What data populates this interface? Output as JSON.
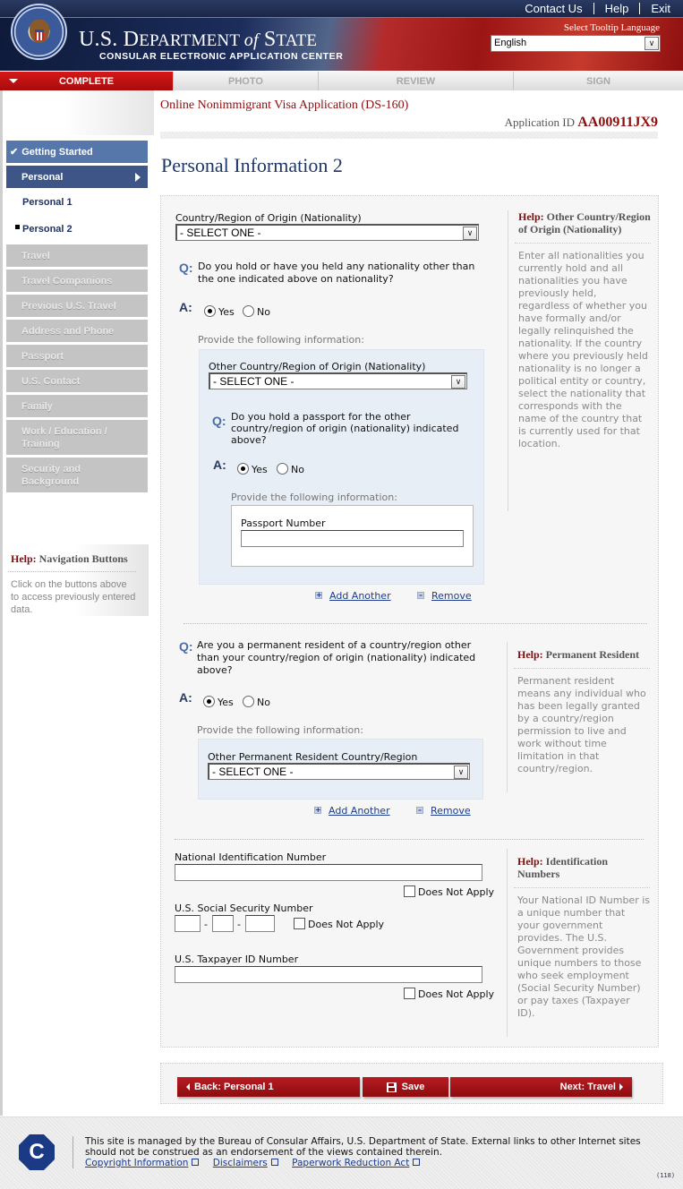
{
  "header": {
    "top_links": [
      "Contact Us",
      "Help",
      "Exit"
    ],
    "dept_name_part1": "U.S. D",
    "dept_name_part1b": "EPARTMENT ",
    "dept_name_of": "of",
    "dept_name_part2": " S",
    "dept_name_part2b": "TATE",
    "subtitle": "CONSULAR ELECTRONIC APPLICATION CENTER",
    "tooltip_language_label": "Select Tooltip Language",
    "tooltip_language_value": "English"
  },
  "progress_tabs": [
    {
      "label": "COMPLETE",
      "active": true
    },
    {
      "label": "PHOTO",
      "active": false
    },
    {
      "label": "REVIEW",
      "active": false
    },
    {
      "label": "SIGN",
      "active": false
    }
  ],
  "app": {
    "title": "Online Nonimmigrant Visa Application (DS-160)",
    "id_label": "Application ID",
    "id_value": "AA00911JX9"
  },
  "sidebar": {
    "completed": "Getting Started",
    "current": "Personal",
    "sub_items": [
      "Personal 1",
      "Personal 2"
    ],
    "locked_items": [
      "Travel",
      "Travel Companions",
      "Previous U.S. Travel",
      "Address and Phone",
      "Passport",
      "U.S. Contact",
      "Family",
      "Work / Education / Training",
      "Security and Background"
    ],
    "help_title_prefix": "Help:",
    "help_title": "Navigation Buttons",
    "help_text": "Click on the buttons above to access previously entered data."
  },
  "page": {
    "title": "Personal Information 2"
  },
  "section_nationality": {
    "nationality_label": "Country/Region of Origin (Nationality)",
    "nationality_value": "- SELECT ONE -",
    "q1_marker": "Q:",
    "q1_text": "Do you hold or have you held any nationality other than the one indicated above on nationality?",
    "a_marker": "A:",
    "q1_answer_yes": "Yes",
    "q1_answer_no": "No",
    "q1_selected": "Yes",
    "provide_info": "Provide the following information:",
    "other_nationality_label": "Other Country/Region of Origin (Nationality)",
    "other_nationality_value": "- SELECT ONE -",
    "q2_text": "Do you hold a passport for the other country/region of origin (nationality) indicated above?",
    "q2_answer_yes": "Yes",
    "q2_answer_no": "No",
    "q2_selected": "Yes",
    "passport_label": "Passport Number",
    "passport_value": "",
    "add_another": "Add Another",
    "remove": "Remove",
    "help_prefix": "Help:",
    "help_title": "Other Country/Region of Origin (Nationality)",
    "help_text": "Enter all nationalities you currently hold and all nationalities you have previously held, regardless of whether you have formally and/or legally relinquished the nationality. If the country where you previously held nationality is no longer a political entity or country, select the nationality that corresponds with the name of the country that is currently used for that location."
  },
  "section_resident": {
    "q_text": "Are you a permanent resident of a country/region other than your country/region of origin (nationality) indicated above?",
    "answer_yes": "Yes",
    "answer_no": "No",
    "selected": "Yes",
    "provide_info": "Provide the following information:",
    "country_label": "Other Permanent Resident Country/Region",
    "country_value": "- SELECT ONE -",
    "add_another": "Add Another",
    "remove": "Remove",
    "help_prefix": "Help:",
    "help_title": "Permanent Resident",
    "help_text": "Permanent resident means any individual who has been legally granted by a country/region permission to live and work without time limitation in that country/region."
  },
  "section_ids": {
    "national_id_label": "National Identification Number",
    "national_id_value": "",
    "does_not_apply": "Does Not Apply",
    "ssn_label": "U.S. Social Security Number",
    "ssn_sep": "-",
    "ssn_values": [
      "",
      "",
      ""
    ],
    "taxpayer_label": "U.S. Taxpayer ID Number",
    "taxpayer_value": "",
    "help_prefix": "Help:",
    "help_title": "Identification Numbers",
    "help_text": "Your National ID Number is a unique number that your government provides. The U.S. Government provides unique numbers to those who seek employment (Social Security Number) or pay taxes (Taxpayer ID)."
  },
  "nav_buttons": {
    "back": "Back: Personal 1",
    "save": "Save",
    "next": "Next: Travel"
  },
  "footer": {
    "logo_letter": "C",
    "text": "This site is managed by the Bureau of Consular Affairs, U.S. Department of State. External links to other Internet sites should not be construed as an endorsement of the views contained therein.",
    "links": [
      "Copyright Information",
      "Disclaimers",
      "Paperwork Reduction Act"
    ],
    "build": "(118)"
  }
}
